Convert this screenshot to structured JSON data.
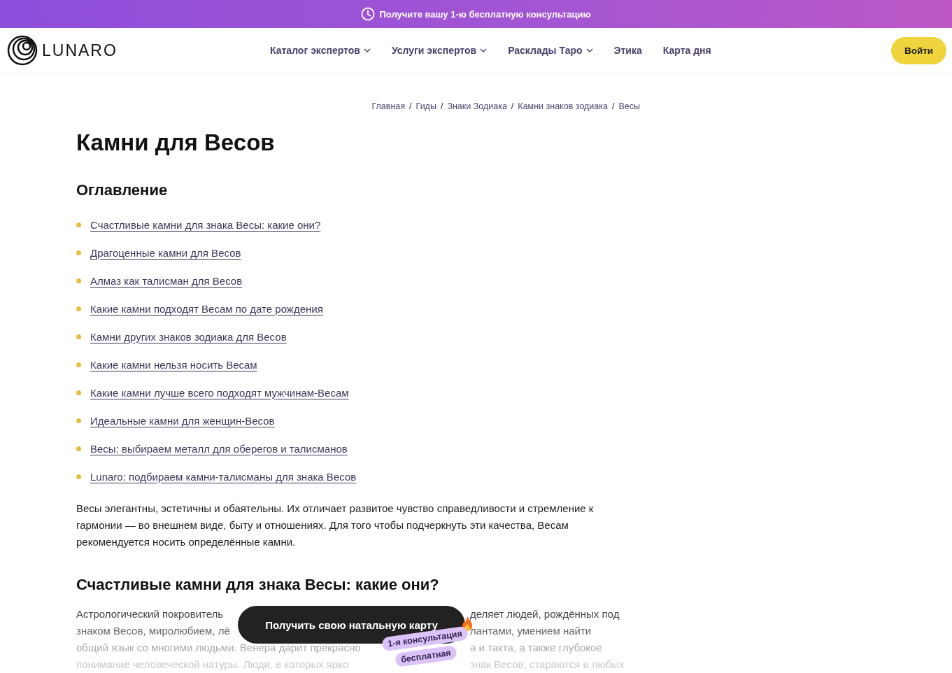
{
  "promo_bar": {
    "text": "Получите вашу **1-ю бесплатную консультацию**"
  },
  "header": {
    "logo": "LUNARO",
    "nav": [
      {
        "label": "Каталог экспертов",
        "dropdown": true
      },
      {
        "label": "Услуги экспертов",
        "dropdown": true
      },
      {
        "label": "Расклады Таро",
        "dropdown": true
      },
      {
        "label": "Этика",
        "dropdown": false
      },
      {
        "label": "Карта дня",
        "dropdown": false
      }
    ],
    "login_button": "Войти"
  },
  "breadcrumbs": [
    {
      "kind": "link",
      "text": "Главная"
    },
    {
      "kind": "separator",
      "text": "/"
    },
    {
      "kind": "link",
      "text": "Гиды"
    },
    {
      "kind": "separator",
      "text": "/"
    },
    {
      "kind": "link",
      "text": "Знаки Зодиака"
    },
    {
      "kind": "separator",
      "text": "/"
    },
    {
      "kind": "link",
      "text": "Камни знаков зодиака"
    },
    {
      "kind": "separator",
      "text": "/"
    },
    {
      "kind": "link",
      "text": "Весы"
    }
  ],
  "title": "Камни для Весов",
  "toc": {
    "heading": "Оглавление",
    "items": [
      "Счастливые камни для знака Весы: какие они?",
      "Драгоценные камни для Весов",
      "Алмаз как талисман для Весов",
      "Какие камни подходят Весам по дате рождения",
      "Камни других знаков зодиака для Весов",
      "Какие камни нельзя носить Весам",
      "Какие камни лучше всего подходят мужчинам-Весам",
      "Идеальные камни для женщин-Весов",
      "Весы: выбираем металл для оберегов и талисманов",
      "Lunaro: подбираем камни-талисманы для знака Весов"
    ]
  },
  "intro": "Весы элегантны, эстетичны и обаятельны. Их отличает развитое чувство справедливости и стремление к гармонии — во внешнем виде, быту и отношениях. Для того чтобы подчеркнуть эти качества, Весам рекомендуется носить определённые камни.",
  "section": {
    "heading": "Счастливые камни для знака Весы: какие они?",
    "lines": [
      {
        "left": "Астрологический покровитель",
        "right": "деляет людей, рождённых под"
      },
      {
        "left": "знаком Весов, миролюбием, лё",
        "right": "лантами, умением найти"
      },
      {
        "left": "общий язык со многими людьми. Венера дарит прекрасно",
        "right": "а и такта, а также глубокое"
      },
      {
        "left": "понимание человеческой натуры. Люди, в которых ярко",
        "right": "знак Весов, стараются в любых"
      }
    ]
  },
  "floating_cta": {
    "label": "Получить свою натальную карту",
    "badge_line_1": "1-я консультация",
    "badge_line_2": "бесплатная"
  }
}
